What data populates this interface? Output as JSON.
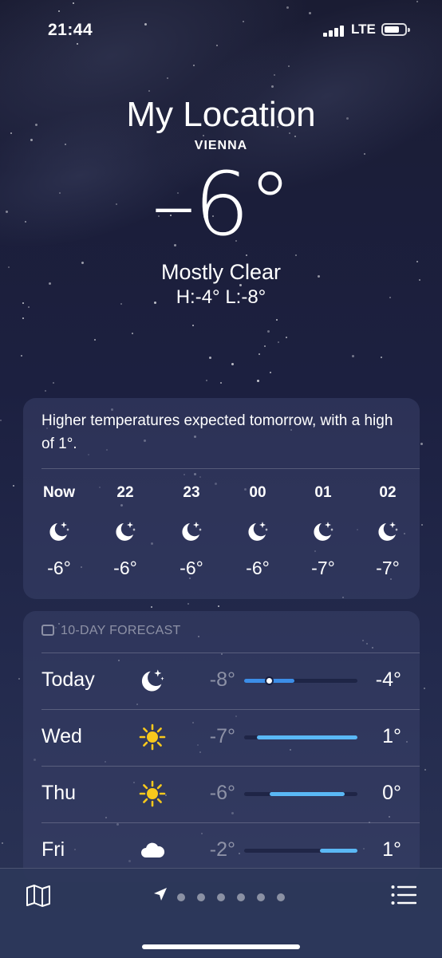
{
  "status_bar": {
    "time": "21:44",
    "network": "LTE"
  },
  "header": {
    "location_title": "My Location",
    "city": "VIENNA",
    "temperature": "–6°",
    "condition": "Mostly Clear",
    "high_low": "H:-4°  L:-8°"
  },
  "hourly": {
    "summary": "Higher temperatures expected tomorrow, with a high of 1°.",
    "items": [
      {
        "hour": "Now",
        "icon": "moon-stars-icon",
        "temp": "-6°"
      },
      {
        "hour": "22",
        "icon": "moon-stars-icon",
        "temp": "-6°"
      },
      {
        "hour": "23",
        "icon": "moon-stars-icon",
        "temp": "-6°"
      },
      {
        "hour": "00",
        "icon": "moon-stars-icon",
        "temp": "-6°"
      },
      {
        "hour": "01",
        "icon": "moon-stars-icon",
        "temp": "-7°"
      },
      {
        "hour": "02",
        "icon": "moon-stars-icon",
        "temp": "-7°"
      }
    ]
  },
  "forecast": {
    "title": "10-DAY FORECAST",
    "range_min": -8,
    "range_max": 1,
    "days": [
      {
        "day": "Today",
        "icon": "moon-stars-icon",
        "low": "-8°",
        "high": "-4°",
        "low_value": -8,
        "high_value": -4,
        "current_value": -6
      },
      {
        "day": "Wed",
        "icon": "sun-icon",
        "low": "-7°",
        "high": "1°",
        "low_value": -7,
        "high_value": 1
      },
      {
        "day": "Thu",
        "icon": "sun-icon",
        "low": "-6°",
        "high": "0°",
        "low_value": -6,
        "high_value": 0
      },
      {
        "day": "Fri",
        "icon": "cloud-icon",
        "low": "-2°",
        "high": "1°",
        "low_value": -2,
        "high_value": 1
      }
    ]
  },
  "toolbar": {
    "page_count": 6,
    "active_page": 0
  },
  "colors": {
    "range_bar": "#5ab8f5",
    "range_bar_cold": "#3c8ee8",
    "track": "#1a2040"
  }
}
